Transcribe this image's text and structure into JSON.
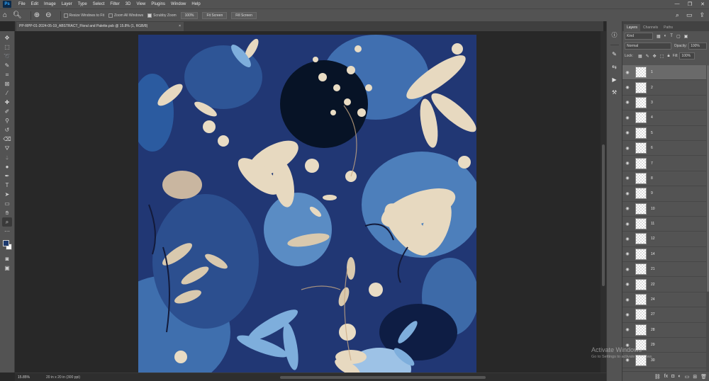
{
  "menubar": {
    "logo": "Ps",
    "items": [
      "File",
      "Edit",
      "Image",
      "Layer",
      "Type",
      "Select",
      "Filter",
      "3D",
      "View",
      "Plugins",
      "Window",
      "Help"
    ],
    "window_controls": [
      "—",
      "❐",
      "✕"
    ]
  },
  "options_bar": {
    "checks": [
      {
        "label": "Resize Windows to Fit",
        "on": false
      },
      {
        "label": "Zoom All Windows",
        "on": false
      },
      {
        "label": "Scrubby Zoom",
        "on": true
      }
    ],
    "buttons": [
      "100%",
      "Fit Screen",
      "Fill Screen"
    ]
  },
  "document_tab": {
    "title": "PP-RPP-01-2024-05-19_ABSTRACT_Floral and Palette.psb @ 15.8% (1, RGB/8)",
    "close": "×"
  },
  "status_bar": {
    "zoom": "15.85%",
    "doc_info": "20 in x 20 in (300 ppi)"
  },
  "layers_panel": {
    "tabs": [
      "Layers",
      "Channels",
      "Paths"
    ],
    "kind_filter": "Kind",
    "blend_mode": "Normal",
    "opacity_label": "Opacity:",
    "opacity_value": "100%",
    "lock_label": "Lock:",
    "fill_label": "Fill:",
    "fill_value": "100%",
    "layers": [
      {
        "name": "1",
        "selected": true
      },
      {
        "name": "2"
      },
      {
        "name": "3"
      },
      {
        "name": "4"
      },
      {
        "name": "5"
      },
      {
        "name": "6"
      },
      {
        "name": "7"
      },
      {
        "name": "8"
      },
      {
        "name": "9"
      },
      {
        "name": "10"
      },
      {
        "name": "11"
      },
      {
        "name": "12"
      },
      {
        "name": "14"
      },
      {
        "name": "21"
      },
      {
        "name": "22"
      },
      {
        "name": "24"
      },
      {
        "name": "27"
      },
      {
        "name": "28"
      },
      {
        "name": "29"
      },
      {
        "name": "30"
      }
    ]
  },
  "watermark": {
    "line1": "Activate Windows",
    "line2": "Go to Settings to activate Windows."
  }
}
